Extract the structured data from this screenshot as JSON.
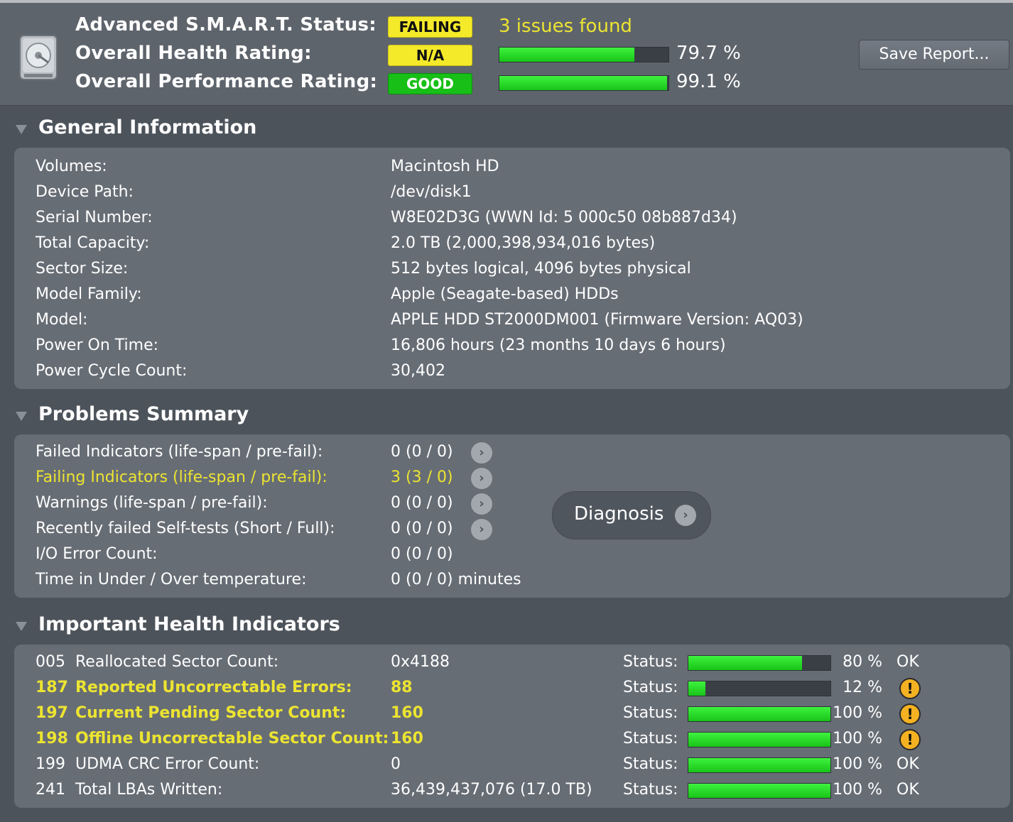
{
  "header": {
    "smart_label": "Advanced S.M.A.R.T. Status:",
    "smart_badge": "FAILING",
    "issues_text": "3 issues found",
    "health_label": "Overall Health Rating:",
    "health_badge": "N/A",
    "health_pct": "79.7 %",
    "health_value": 79.7,
    "perf_label": "Overall Performance Rating:",
    "perf_badge": "GOOD",
    "perf_pct": "99.1 %",
    "perf_value": 99.1,
    "save_label": "Save Report..."
  },
  "colors": {
    "background": "#4d535b",
    "panel": "#676d75",
    "badge_yellow": "#f5ea2a",
    "badge_green": "#17bf17",
    "bar_fill": "#2ed82e",
    "warning_text": "#ece431",
    "warning_icon": "#f4b222"
  },
  "icons": [
    "hard-drive-icon",
    "disclosure-triangle-icon",
    "chevron-right-icon",
    "warning-icon"
  ],
  "general": {
    "title": "General Information",
    "rows": [
      {
        "label": "Volumes:",
        "value": "Macintosh HD"
      },
      {
        "label": "Device Path:",
        "value": "/dev/disk1"
      },
      {
        "label": "Serial Number:",
        "value": "W8E02D3G (WWN Id: 5 000c50 08b887d34)"
      },
      {
        "label": "Total Capacity:",
        "value": "2.0 TB (2,000,398,934,016 bytes)"
      },
      {
        "label": "Sector Size:",
        "value": "512 bytes logical, 4096 bytes physical"
      },
      {
        "label": "Model Family:",
        "value": "Apple (Seagate-based) HDDs"
      },
      {
        "label": "Model:",
        "value": "APPLE HDD ST2000DM001  (Firmware Version: AQ03)"
      },
      {
        "label": "Power On Time:",
        "value": "16,806 hours (23 months 10 days 6 hours)"
      },
      {
        "label": "Power Cycle Count:",
        "value": "30,402"
      }
    ]
  },
  "problems": {
    "title": "Problems Summary",
    "rows": [
      {
        "label": "Failed Indicators (life-span / pre-fail):",
        "value": "0  (0 / 0)"
      },
      {
        "label": "Failing Indicators (life-span / pre-fail):",
        "value": "3  (3 / 0)"
      },
      {
        "label": "Warnings (life-span / pre-fail):",
        "value": "0  (0 / 0)"
      },
      {
        "label": "Recently failed Self-tests (Short / Full):",
        "value": "0  (0 / 0)"
      },
      {
        "label": "I/O Error Count:",
        "value": "0  (0 / 0)"
      },
      {
        "label": "Time in Under / Over temperature:",
        "value": "0  (0 / 0)   minutes"
      }
    ],
    "diagnosis_label": "Diagnosis"
  },
  "indicators": {
    "title": "Important Health Indicators",
    "status_label": "Status:",
    "rows": [
      {
        "id": "005",
        "name": "Reallocated Sector Count:",
        "value": "0x4188",
        "pct": "80 %",
        "level": 80,
        "state": "OK",
        "warn": false
      },
      {
        "id": "187",
        "name": "Reported Uncorrectable Errors:",
        "value": "88",
        "pct": "12 %",
        "level": 12,
        "state": "!",
        "warn": true
      },
      {
        "id": "197",
        "name": "Current Pending Sector Count:",
        "value": "160",
        "pct": "100 %",
        "level": 100,
        "state": "!",
        "warn": true
      },
      {
        "id": "198",
        "name": "Offline Uncorrectable Sector Count:",
        "value": "160",
        "pct": "100 %",
        "level": 100,
        "state": "!",
        "warn": true
      },
      {
        "id": "199",
        "name": "UDMA CRC Error Count:",
        "value": "0",
        "pct": "100 %",
        "level": 100,
        "state": "OK",
        "warn": false
      },
      {
        "id": "241",
        "name": "Total LBAs Written:",
        "value": "36,439,437,076 (17.0 TB)",
        "pct": "100 %",
        "level": 100,
        "state": "OK",
        "warn": false
      }
    ]
  }
}
